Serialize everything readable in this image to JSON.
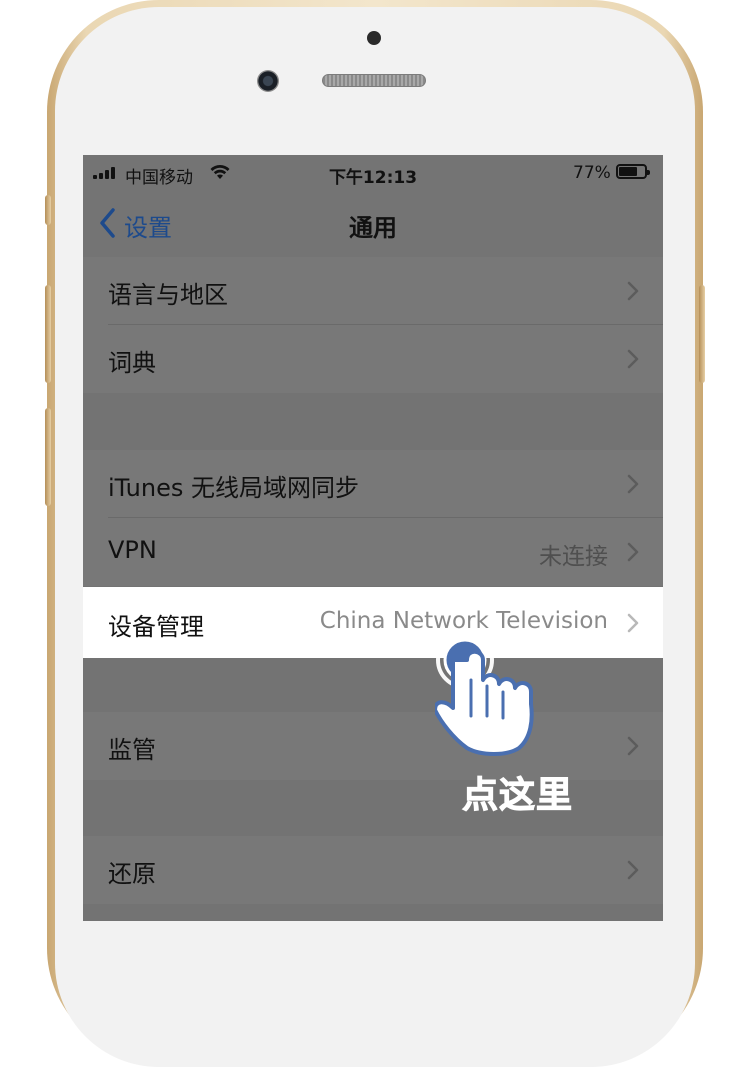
{
  "status_bar": {
    "carrier": "中国移动",
    "time": "下午12:13",
    "battery_percent": "77%",
    "battery_level": 0.77,
    "signal_icon": "signal-bars-icon",
    "wifi_icon": "wifi-icon"
  },
  "nav": {
    "back_label": "设置",
    "title": "通用"
  },
  "rows": [
    {
      "label": "语言与地区",
      "value": ""
    },
    {
      "label": "词典",
      "value": ""
    },
    {
      "label": "iTunes 无线局域网同步",
      "value": ""
    },
    {
      "label": "VPN",
      "value": "未连接"
    },
    {
      "label": "设备管理",
      "value": "China Network Television"
    },
    {
      "label": "监管",
      "value": ""
    },
    {
      "label": "还原",
      "value": ""
    }
  ],
  "annotation": {
    "tap_label": "点这里",
    "hand_icon": "tap-hand-icon",
    "accent_color": "#4a6fb0"
  },
  "colors": {
    "phone_gold": "#e8d3ad",
    "overlay_gray": "#737373",
    "highlight_row": "#ffffff",
    "back_blue": "#1d4a8c"
  }
}
